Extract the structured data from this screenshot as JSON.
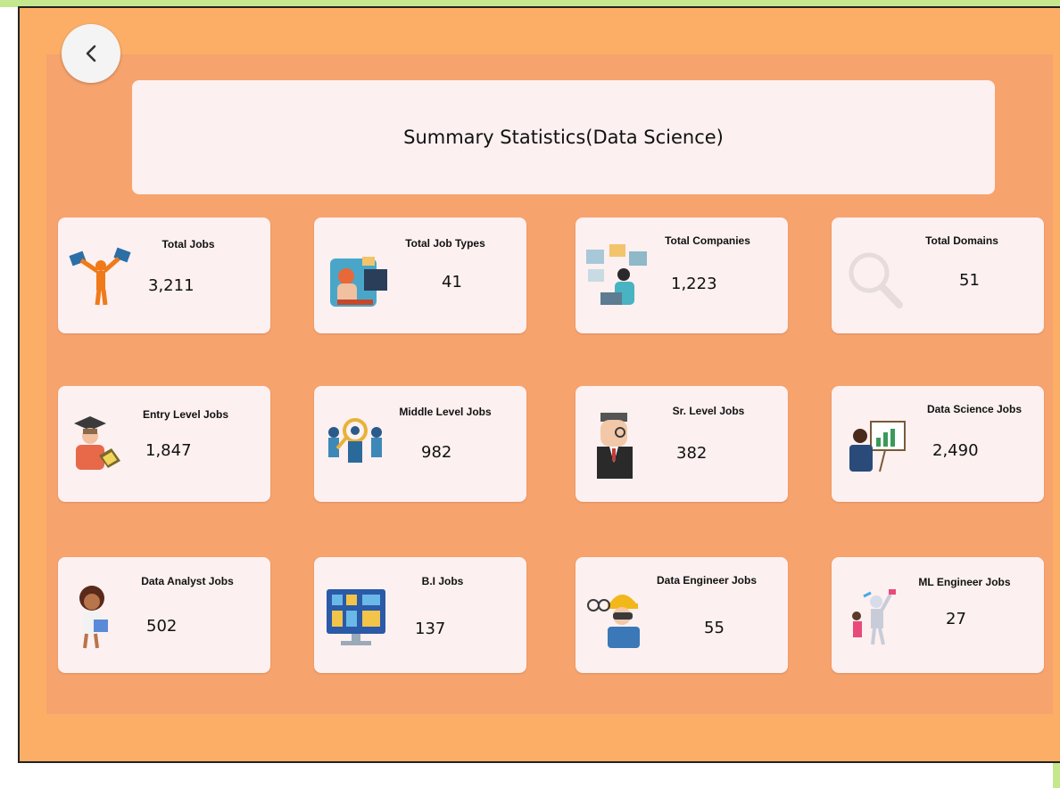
{
  "header": {
    "title": "Summary Statistics(Data Science)"
  },
  "back_button": {
    "icon": "chevron-left-icon"
  },
  "cards": [
    {
      "label": "Total Jobs",
      "value": "3,211",
      "icon": "person-holding-files-icon"
    },
    {
      "label": "Total Job Types",
      "value": "41",
      "icon": "worker-at-computer-icon"
    },
    {
      "label": "Total Companies",
      "value": "1,223",
      "icon": "office-screens-icon"
    },
    {
      "label": "Total Domains",
      "value": "51",
      "icon": "magnifier-icon"
    },
    {
      "label": "Entry Level Jobs",
      "value": "1,847",
      "icon": "graduate-icon"
    },
    {
      "label": "Middle Level Jobs",
      "value": "982",
      "icon": "team-search-icon"
    },
    {
      "label": "Sr. Level Jobs",
      "value": "382",
      "icon": "senior-man-icon"
    },
    {
      "label": "Data Science Jobs",
      "value": "2,490",
      "icon": "presenter-chart-icon"
    },
    {
      "label": "Data Analyst Jobs",
      "value": "502",
      "icon": "analyst-woman-icon"
    },
    {
      "label": "B.I Jobs",
      "value": "137",
      "icon": "dashboard-monitor-icon"
    },
    {
      "label": "Data Engineer Jobs",
      "value": "55",
      "icon": "engineer-helmet-icon"
    },
    {
      "label": "ML Engineer Jobs",
      "value": "27",
      "icon": "robot-human-icon"
    }
  ],
  "colors": {
    "background": "#fdae66",
    "panel": "#f7a36d",
    "card": "#fcf0f0",
    "accent_green": "#c5e88e"
  }
}
